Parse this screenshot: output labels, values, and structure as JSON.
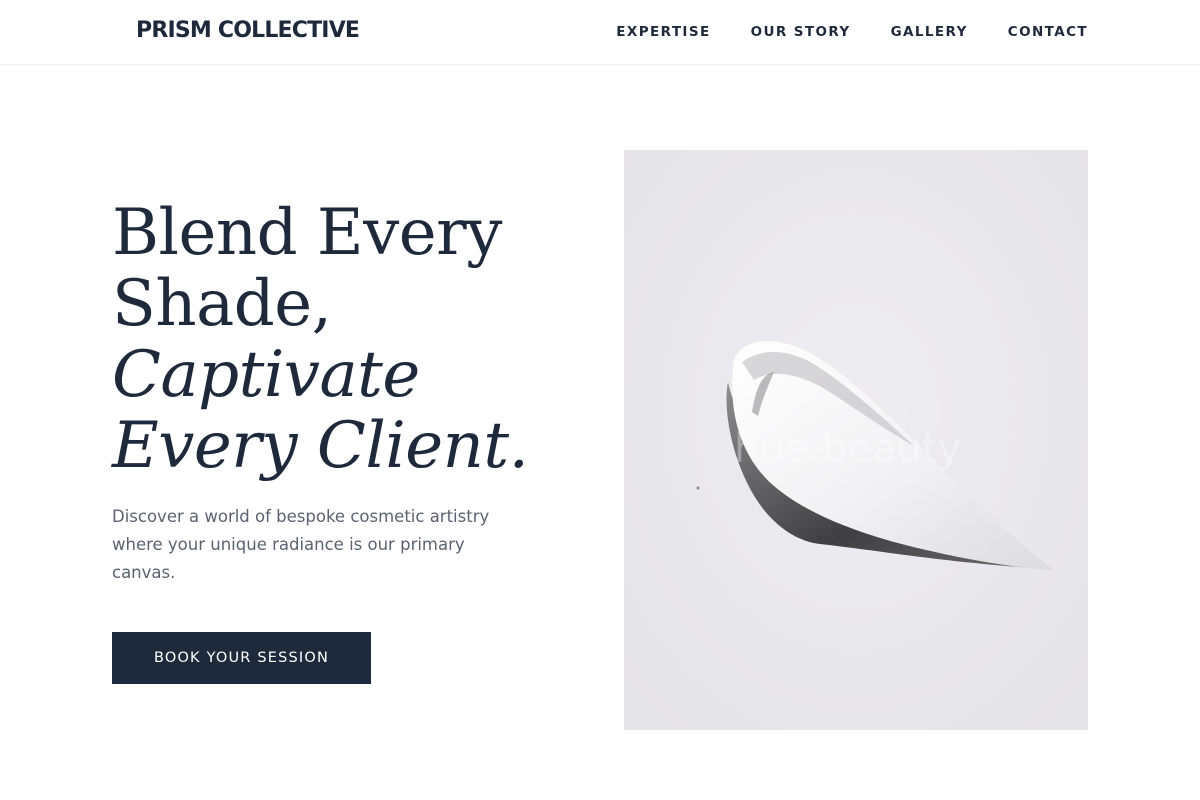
{
  "header": {
    "brand": "PRISM COLLECTIVE",
    "nav": [
      {
        "label": "EXPERTISE"
      },
      {
        "label": "OUR STORY"
      },
      {
        "label": "GALLERY"
      },
      {
        "label": "CONTACT"
      }
    ]
  },
  "hero": {
    "headline": {
      "line1": "Blend Every",
      "line2": "Shade,",
      "line3": "Captivate",
      "line4": "Every Client."
    },
    "subtext": "Discover a world of bespoke cosmetic artistry where your unique radiance is our primary canvas.",
    "cta_label": "BOOK YOUR SESSION",
    "image_watermark": "hue.beauty"
  },
  "colors": {
    "primary": "#1e293b",
    "body_text": "#5b6270",
    "image_bg": "#e9e8ec",
    "background": "#ffffff"
  }
}
